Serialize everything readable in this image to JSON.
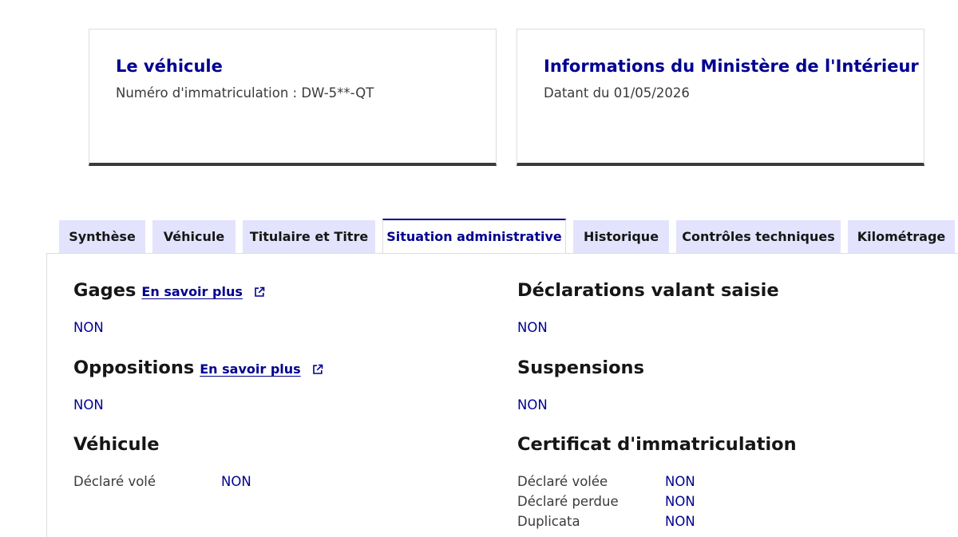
{
  "cards": {
    "vehicle": {
      "title": "Le véhicule",
      "subtitle": "Numéro d'immatriculation : DW-5**-QT"
    },
    "ministry": {
      "title": "Informations du Ministère de l'Intérieur",
      "subtitle": "Datant du 01/05/2026"
    }
  },
  "tabs": [
    {
      "label": "Synthèse"
    },
    {
      "label": "Véhicule"
    },
    {
      "label": "Titulaire et Titre"
    },
    {
      "label": "Situation administrative"
    },
    {
      "label": "Historique"
    },
    {
      "label": "Contrôles techniques"
    },
    {
      "label": "Kilométrage"
    }
  ],
  "active_tab": "Situation administrative",
  "sections": {
    "gages": {
      "title": "Gages",
      "link": "En savoir plus",
      "value": "NON"
    },
    "oppositions": {
      "title": "Oppositions",
      "link": "En savoir plus",
      "value": "NON"
    },
    "vehicule": {
      "title": "Véhicule",
      "rows": [
        {
          "label": "Déclaré volé",
          "value": "NON"
        }
      ]
    },
    "saisie": {
      "title": "Déclarations valant saisie",
      "value": "NON"
    },
    "suspensions": {
      "title": "Suspensions",
      "value": "NON"
    },
    "certificat": {
      "title": "Certificat d'immatriculation",
      "rows": [
        {
          "label": "Déclaré volée",
          "value": "NON"
        },
        {
          "label": "Déclaré perdue",
          "value": "NON"
        },
        {
          "label": "Duplicata",
          "value": "NON"
        }
      ]
    }
  },
  "colors": {
    "primary": "#000091",
    "tab_bg": "#e3e3fd",
    "text": "#161616",
    "muted": "#3a3a3a"
  }
}
